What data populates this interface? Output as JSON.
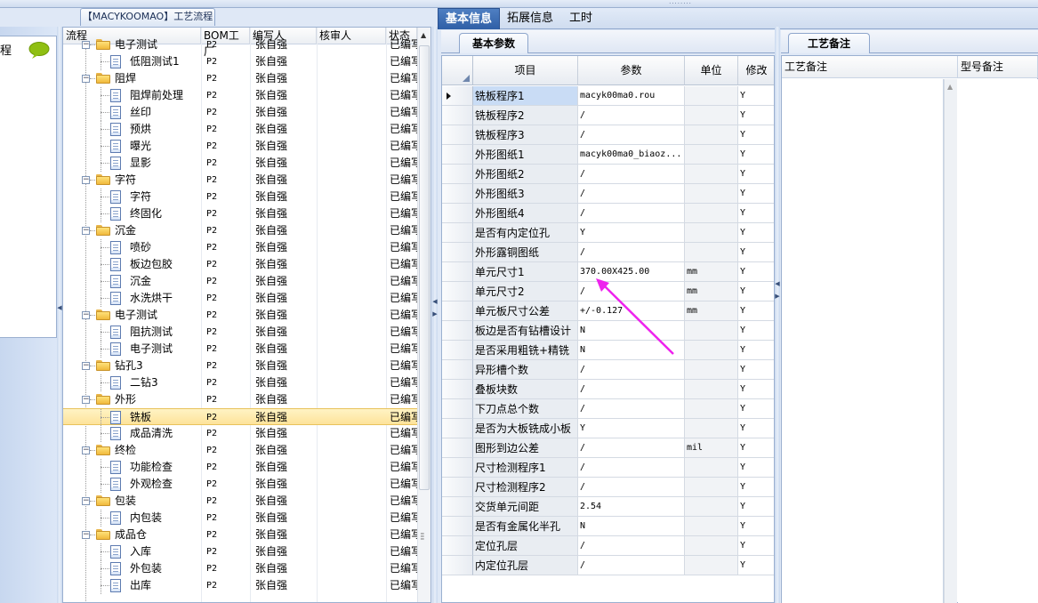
{
  "top_grip": "········",
  "left_pane": {
    "label": "程"
  },
  "tree_title": "【MACYKOOMAO】工艺流程",
  "tree_columns": [
    "流程",
    "BOM工厂",
    "编写人",
    "核审人",
    "状态"
  ],
  "tree_rows": [
    {
      "level": 0,
      "label": "电子测试",
      "factory": "P2",
      "writer": "张自强",
      "status": "已编写",
      "folder": true
    },
    {
      "level": 1,
      "label": "低阻测试1",
      "factory": "P2",
      "writer": "张自强",
      "status": "已编写"
    },
    {
      "level": 0,
      "label": "阻焊",
      "factory": "P2",
      "writer": "张自强",
      "status": "已编写",
      "folder": true
    },
    {
      "level": 1,
      "label": "阻焊前处理",
      "factory": "P2",
      "writer": "张自强",
      "status": "已编写"
    },
    {
      "level": 1,
      "label": "丝印",
      "factory": "P2",
      "writer": "张自强",
      "status": "已编写"
    },
    {
      "level": 1,
      "label": "预烘",
      "factory": "P2",
      "writer": "张自强",
      "status": "已编写"
    },
    {
      "level": 1,
      "label": "曝光",
      "factory": "P2",
      "writer": "张自强",
      "status": "已编写"
    },
    {
      "level": 1,
      "label": "显影",
      "factory": "P2",
      "writer": "张自强",
      "status": "已编写"
    },
    {
      "level": 0,
      "label": "字符",
      "factory": "P2",
      "writer": "张自强",
      "status": "已编写",
      "folder": true
    },
    {
      "level": 1,
      "label": "字符",
      "factory": "P2",
      "writer": "张自强",
      "status": "已编写"
    },
    {
      "level": 1,
      "label": "终固化",
      "factory": "P2",
      "writer": "张自强",
      "status": "已编写"
    },
    {
      "level": 0,
      "label": "沉金",
      "factory": "P2",
      "writer": "张自强",
      "status": "已编写",
      "folder": true
    },
    {
      "level": 1,
      "label": "喷砂",
      "factory": "P2",
      "writer": "张自强",
      "status": "已编写"
    },
    {
      "level": 1,
      "label": "板边包胶",
      "factory": "P2",
      "writer": "张自强",
      "status": "已编写"
    },
    {
      "level": 1,
      "label": "沉金",
      "factory": "P2",
      "writer": "张自强",
      "status": "已编写"
    },
    {
      "level": 1,
      "label": "水洗烘干",
      "factory": "P2",
      "writer": "张自强",
      "status": "已编写"
    },
    {
      "level": 0,
      "label": "电子测试",
      "factory": "P2",
      "writer": "张自强",
      "status": "已编写",
      "folder": true
    },
    {
      "level": 1,
      "label": "阻抗测试",
      "factory": "P2",
      "writer": "张自强",
      "status": "已编写"
    },
    {
      "level": 1,
      "label": "电子测试",
      "factory": "P2",
      "writer": "张自强",
      "status": "已编写"
    },
    {
      "level": 0,
      "label": "钻孔3",
      "factory": "P2",
      "writer": "张自强",
      "status": "已编写",
      "folder": true
    },
    {
      "level": 1,
      "label": "二钻3",
      "factory": "P2",
      "writer": "张自强",
      "status": "已编写"
    },
    {
      "level": 0,
      "label": "外形",
      "factory": "P2",
      "writer": "张自强",
      "status": "已编写",
      "folder": true
    },
    {
      "level": 1,
      "label": "铣板",
      "factory": "P2",
      "writer": "张自强",
      "status": "已编写",
      "selected": true
    },
    {
      "level": 1,
      "label": "成品清洗",
      "factory": "P2",
      "writer": "张自强",
      "status": "已编写"
    },
    {
      "level": 0,
      "label": "终检",
      "factory": "P2",
      "writer": "张自强",
      "status": "已编写",
      "folder": true
    },
    {
      "level": 1,
      "label": "功能检查",
      "factory": "P2",
      "writer": "张自强",
      "status": "已编写"
    },
    {
      "level": 1,
      "label": "外观检查",
      "factory": "P2",
      "writer": "张自强",
      "status": "已编写"
    },
    {
      "level": 0,
      "label": "包装",
      "factory": "P2",
      "writer": "张自强",
      "status": "已编写",
      "folder": true
    },
    {
      "level": 1,
      "label": "内包装",
      "factory": "P2",
      "writer": "张自强",
      "status": "已编写"
    },
    {
      "level": 0,
      "label": "成品仓",
      "factory": "P2",
      "writer": "张自强",
      "status": "已编写",
      "folder": true
    },
    {
      "level": 1,
      "label": "入库",
      "factory": "P2",
      "writer": "张自强",
      "status": "已编写"
    },
    {
      "level": 1,
      "label": "外包装",
      "factory": "P2",
      "writer": "张自强",
      "status": "已编写"
    },
    {
      "level": 1,
      "label": "出库",
      "factory": "P2",
      "writer": "张自强",
      "status": "已编写"
    }
  ],
  "main_tabs": [
    "基本信息",
    "拓展信息",
    "工时"
  ],
  "subtab_basic": "基本参数",
  "param_columns": [
    "项目",
    "参数",
    "单位",
    "修改"
  ],
  "params": [
    {
      "item": "铣板程序1",
      "value": "macyk00ma0.rou",
      "unit": "",
      "mod": "Y"
    },
    {
      "item": "铣板程序2",
      "value": "/",
      "unit": "",
      "mod": "Y"
    },
    {
      "item": "铣板程序3",
      "value": "/",
      "unit": "",
      "mod": "Y"
    },
    {
      "item": "外形图纸1",
      "value": "macyk00ma0_biaoz...",
      "unit": "",
      "mod": "Y"
    },
    {
      "item": "外形图纸2",
      "value": "/",
      "unit": "",
      "mod": "Y"
    },
    {
      "item": "外形图纸3",
      "value": "/",
      "unit": "",
      "mod": "Y"
    },
    {
      "item": "外形图纸4",
      "value": "/",
      "unit": "",
      "mod": "Y"
    },
    {
      "item": "是否有内定位孔",
      "value": "Y",
      "unit": "",
      "mod": "Y"
    },
    {
      "item": "外形露铜图纸",
      "value": "/",
      "unit": "",
      "mod": "Y"
    },
    {
      "item": "单元尺寸1",
      "value": "370.00X425.00",
      "unit": "mm",
      "mod": "Y"
    },
    {
      "item": "单元尺寸2",
      "value": "/",
      "unit": "mm",
      "mod": "Y"
    },
    {
      "item": "单元板尺寸公差",
      "value": "+/-0.127",
      "unit": "mm",
      "mod": "Y"
    },
    {
      "item": "板边是否有钻槽设计",
      "value": "N",
      "unit": "",
      "mod": "Y"
    },
    {
      "item": "是否采用粗铣+精铣",
      "value": "N",
      "unit": "",
      "mod": "Y"
    },
    {
      "item": "异形槽个数",
      "value": "/",
      "unit": "",
      "mod": "Y"
    },
    {
      "item": "叠板块数",
      "value": "/",
      "unit": "",
      "mod": "Y"
    },
    {
      "item": "下刀点总个数",
      "value": "/",
      "unit": "",
      "mod": "Y"
    },
    {
      "item": "是否为大板铣成小板",
      "value": "Y",
      "unit": "",
      "mod": "Y"
    },
    {
      "item": "图形到边公差",
      "value": "/",
      "unit": "mil",
      "mod": "Y"
    },
    {
      "item": "尺寸检测程序1",
      "value": "/",
      "unit": "",
      "mod": "Y"
    },
    {
      "item": "尺寸检测程序2",
      "value": "/",
      "unit": "",
      "mod": "Y"
    },
    {
      "item": "交货单元间距",
      "value": "2.54",
      "unit": "",
      "mod": "Y"
    },
    {
      "item": "是否有金属化半孔",
      "value": "N",
      "unit": "",
      "mod": "Y"
    },
    {
      "item": "定位孔层",
      "value": "/",
      "unit": "",
      "mod": "Y"
    },
    {
      "item": "内定位孔层",
      "value": "/",
      "unit": "",
      "mod": "Y"
    }
  ],
  "subtab_notes": "工艺备注",
  "notes_columns": [
    "工艺备注",
    "型号备注"
  ],
  "annotation_color": "#ee22ee"
}
